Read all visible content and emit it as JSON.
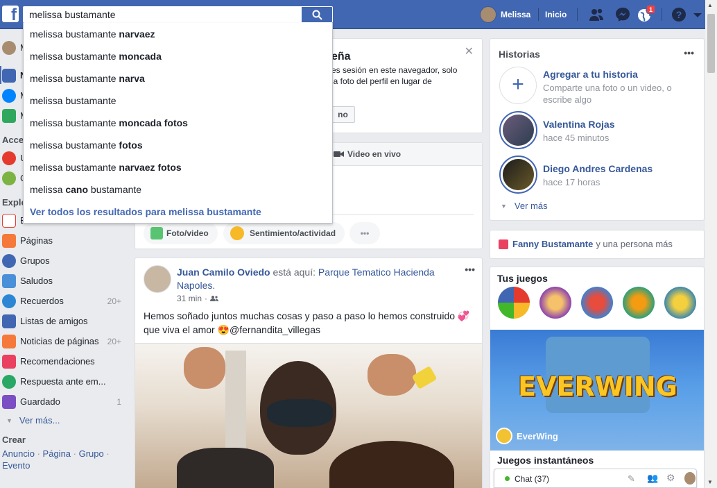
{
  "topbar": {
    "search_value": "melissa bustamante",
    "user_name": "Melissa",
    "home_label": "Inicio",
    "notification_count": "1"
  },
  "dropdown": {
    "suggestions": [
      {
        "prefix": "melissa bustamante ",
        "bold": "narvaez",
        "suffix": ""
      },
      {
        "prefix": "melissa bustamante ",
        "bold": "moncada",
        "suffix": ""
      },
      {
        "prefix": "melissa bustamante ",
        "bold": "narva",
        "suffix": ""
      },
      {
        "prefix": "melissa bustamante",
        "bold": "",
        "suffix": ""
      },
      {
        "prefix": "melissa bustamante ",
        "bold": "moncada fotos",
        "suffix": ""
      },
      {
        "prefix": "melissa bustamante ",
        "bold": "fotos",
        "suffix": ""
      },
      {
        "prefix": "melissa bustamante ",
        "bold": "narvaez fotos",
        "suffix": ""
      },
      {
        "prefix": "melissa ",
        "bold": "cano",
        "suffix": " bustamante"
      }
    ],
    "see_all": "Ver todos los resultados para melissa bustamante"
  },
  "leftnav": {
    "user_initial": "M",
    "partial_items": [
      "N",
      "M",
      "M"
    ],
    "shortcuts_header": "Acce",
    "shortcut_items": [
      "U",
      "C"
    ],
    "explore_header": "Explo",
    "explore_items": [
      {
        "label": "E",
        "count": ""
      },
      {
        "label": "Páginas",
        "count": ""
      },
      {
        "label": "Grupos",
        "count": ""
      },
      {
        "label": "Saludos",
        "count": ""
      },
      {
        "label": "Recuerdos",
        "count": "20+"
      },
      {
        "label": "Listas de amigos",
        "count": ""
      },
      {
        "label": "Noticias de páginas",
        "count": "20+"
      },
      {
        "label": "Recomendaciones",
        "count": ""
      },
      {
        "label": "Respuesta ante em...",
        "count": ""
      },
      {
        "label": "Guardado",
        "count": "1"
      }
    ],
    "see_more": "Ver más...",
    "create_header": "Crear",
    "create_links": [
      "Anuncio",
      "Página",
      "Grupo",
      "Evento"
    ]
  },
  "center": {
    "notice_title_partial": "eña",
    "notice_text_1": "es sesión en este navegador, solo",
    "notice_text_2": "la foto del perfil en lugar de",
    "notice_button_partial": "no",
    "live_video_label": "Video en vivo",
    "photo_video_label": "Foto/video",
    "feeling_label": "Sentimiento/actividad",
    "more_label": "•••"
  },
  "post": {
    "author": "Juan Camilo Oviedo",
    "action": "está aquí:",
    "place": "Parque Tematico Hacienda Napoles.",
    "time": "31 min",
    "text_line1": "Hemos soñado juntos muchas cosas y paso a paso lo hemos construido",
    "text_line2_a": "que viva el amor",
    "text_line2_b": "@fernandita_villegas"
  },
  "right": {
    "stories_title": "Historias",
    "add_story_title": "Agregar a tu historia",
    "add_story_sub": "Comparte una foto o un video, o escribe algo",
    "stories": [
      {
        "name": "Valentina Rojas",
        "time": "hace 45 minutos"
      },
      {
        "name": "Diego Andres Cardenas",
        "time": "hace 17 horas"
      }
    ],
    "see_more": "Ver más",
    "birthday_name": "Fanny Bustamante",
    "birthday_rest": "y una persona más",
    "games_title": "Tus juegos",
    "featured_game": "EverWing",
    "featured_logo": "EVERWING",
    "instant_games": "Juegos instantáneos",
    "chat_label": "Chat (37)"
  },
  "colors": {
    "brand": "#4267b2",
    "link": "#365899",
    "online": "#42b72a"
  }
}
